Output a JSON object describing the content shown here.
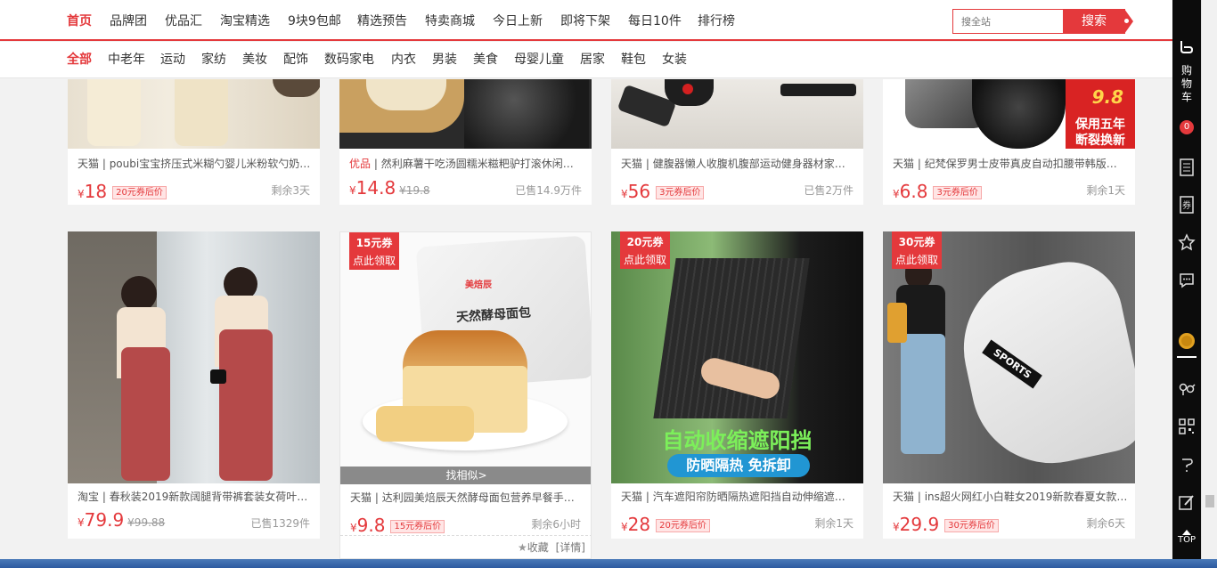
{
  "top_nav": {
    "items": [
      "首页",
      "品牌团",
      "优品汇",
      "淘宝精选",
      "9块9包邮",
      "精选预告",
      "特卖商城",
      "今日上新",
      "即将下架",
      "每日10件",
      "排行榜"
    ],
    "search_placeholder": "搜全站",
    "search_button": "搜索"
  },
  "category_nav": {
    "items": [
      "全部",
      "中老年",
      "运动",
      "家纺",
      "美妆",
      "配饰",
      "数码家电",
      "内衣",
      "男装",
      "美食",
      "母婴儿童",
      "居家",
      "鞋包",
      "女装"
    ]
  },
  "products_row1": [
    {
      "source": "天猫",
      "title": " | poubi宝宝挤压式米糊勺婴儿米粉软勺奶…",
      "yen": "¥",
      "price": "18",
      "orig": "",
      "coupon": "20元券后价",
      "meta": "剩余3天"
    },
    {
      "source": "优品",
      "title": " | 然利麻薯干吃汤圆糯米糍粑驴打滚休闲…",
      "yen": "¥",
      "price": "14.8",
      "orig": "¥19.8",
      "coupon": "",
      "meta": "已售14.9万件"
    },
    {
      "source": "天猫",
      "title": " | 健腹器懒人收腹机腹部运动健身器材家…",
      "yen": "¥",
      "price": "56",
      "orig": "",
      "coupon": "3元券后价",
      "meta": "已售2万件"
    },
    {
      "source": "天猫",
      "title": " | 纪梵保罗男士皮带真皮自动扣腰带韩版…",
      "yen": "¥",
      "price": "6.8",
      "orig": "",
      "coupon": "3元券后价",
      "meta": "剩余1天",
      "img_text1": "9.8",
      "img_text2": "保用五年",
      "img_text3": "断裂换新"
    }
  ],
  "products_row2": [
    {
      "source": "淘宝",
      "title": " | 春秋装2019新款阔腿背带裤套装女荷叶…",
      "yen": "¥",
      "price": "79.9",
      "orig": "¥99.88",
      "coupon": "",
      "meta": "已售1329件"
    },
    {
      "source": "天猫",
      "title": " | 达利园美焙辰天然酵母面包营养早餐手…",
      "yen": "¥",
      "price": "9.8",
      "orig": "",
      "coupon": "15元券后价",
      "meta": "剩余6小时",
      "badge1": "15元券",
      "badge2": "点此领取",
      "similar": "找相似>",
      "fav": "收藏",
      "detail": "[详情]",
      "pkg_text": "天然酵母面包",
      "pkg_brand": "美焙辰"
    },
    {
      "source": "天猫",
      "title": " | 汽车遮阳帘防晒隔热遮阳挡自动伸缩遮…",
      "yen": "¥",
      "price": "28",
      "orig": "",
      "coupon": "20元券后价",
      "meta": "剩余1天",
      "badge1": "20元券",
      "badge2": "点此领取",
      "img_text1": "自动收缩遮阳挡",
      "img_text2": "防晒隔热  免拆卸"
    },
    {
      "source": "天猫",
      "title": " | ins超火网红小白鞋女2019新款春夏女款…",
      "yen": "¥",
      "price": "29.9",
      "orig": "",
      "coupon": "30元券后价",
      "meta": "剩余6天",
      "badge1": "30元券",
      "badge2": "点此领取",
      "shoe_text": "SPORTS"
    }
  ],
  "toolbar": {
    "cart": [
      "购",
      "物",
      "车"
    ],
    "cart_count": "0",
    "top_label": "TOP"
  },
  "colors": {
    "accent": "#e4393c",
    "toolbar_bg": "#0c0c0c"
  }
}
